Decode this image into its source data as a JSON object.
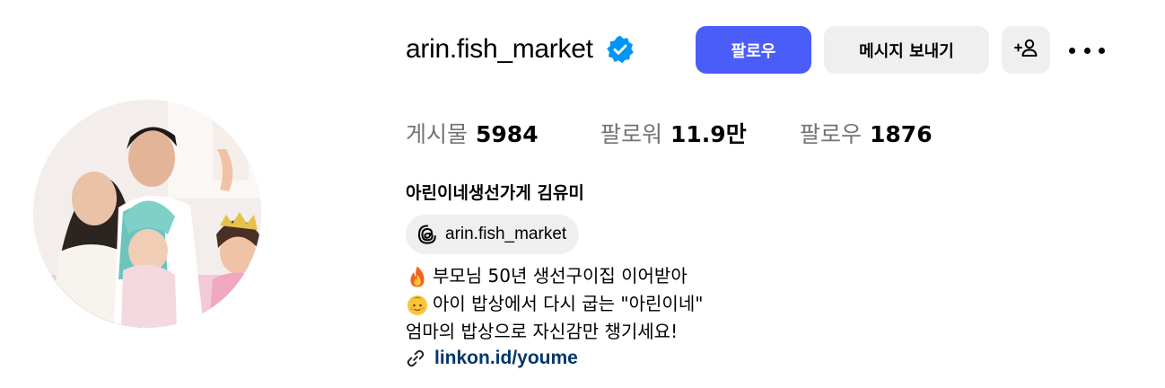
{
  "profile": {
    "username": "arin.fish_market",
    "full_name": "아린이네생선가게 김유미"
  },
  "actions": {
    "follow_label": "팔로우",
    "message_label": "메시지 보내기",
    "add_user_icon": "add-user-icon",
    "more_icon": "more-options-icon"
  },
  "stats": {
    "posts_label": "게시물",
    "posts_count": "5984",
    "followers_label": "팔로워",
    "followers_count": "11.9만",
    "following_label": "팔로우",
    "following_count": "1876"
  },
  "threads": {
    "icon": "threads-icon",
    "handle": "arin.fish_market"
  },
  "bio": {
    "line1": "부모님 50년 생선구이집 이어받아",
    "line2": "아이 밥상에서 다시 굽는 \"아린이네\"",
    "line3": "엄마의 밥상으로 자신감만 챙기세요!",
    "line1_emoji": "fire-emoji",
    "line2_emoji": "baby-emoji"
  },
  "link": {
    "icon": "link-icon",
    "text": "linkon.id/youme"
  },
  "colors": {
    "follow_button": "#4a5df9",
    "secondary_button": "#efefef",
    "muted_text": "#737373",
    "link_text": "#00376b",
    "verified_badge": "#0095f6"
  }
}
